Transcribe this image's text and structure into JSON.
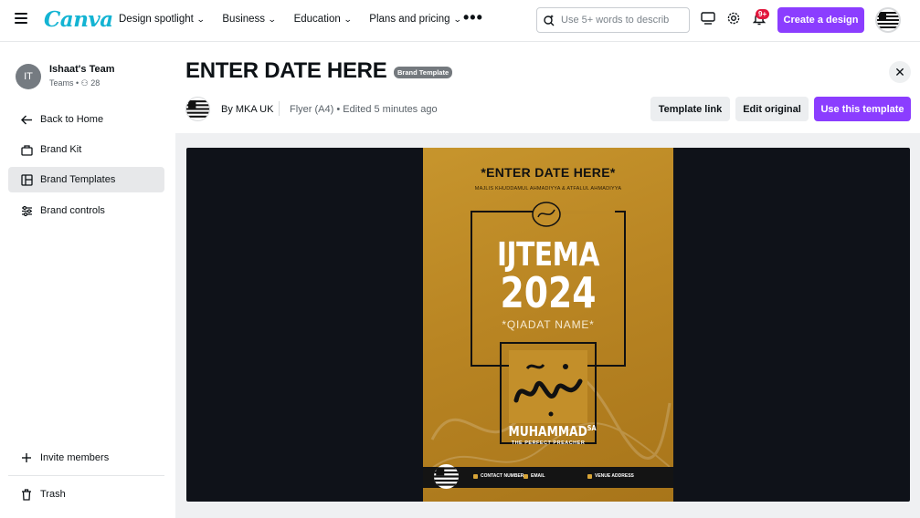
{
  "nav": {
    "logo": "Canva",
    "links": [
      "Design spotlight",
      "Business",
      "Education",
      "Plans and pricing"
    ],
    "search_placeholder": "Use 5+ words to describ",
    "notification_badge": "9+",
    "create_button": "Create a design"
  },
  "sidebar": {
    "team_initials": "IT",
    "team_name": "Ishaat's Team",
    "team_meta": "Teams • & 28",
    "items": [
      {
        "label": "Back to Home",
        "icon": "arrow-left-icon"
      },
      {
        "label": "Brand Kit",
        "icon": "brand-kit-icon"
      },
      {
        "label": "Brand Templates",
        "icon": "templates-icon"
      },
      {
        "label": "Brand controls",
        "icon": "sliders-icon"
      }
    ],
    "invite": "Invite members",
    "trash": "Trash"
  },
  "header": {
    "title": "ENTER DATE HERE",
    "badge": "Brand Template",
    "author": "By MKA UK",
    "meta": "Flyer (A4) • Edited 5 minutes ago",
    "template_link": "Template link",
    "edit_original": "Edit original",
    "use_template": "Use this template"
  },
  "flyer": {
    "date": "*ENTER DATE HERE*",
    "org": "MAJLIS KHUDDAMUL AHMADIYYA & ATFALUL AHMADIYYA",
    "title": "IJTEMA",
    "year": "2024",
    "qiadat": "*QIADAT NAME*",
    "name": "MUHAMMAD",
    "name_sup": "SA",
    "tagline": "THE PERFECT PREACHER",
    "contact": "CONTACT NUMBER",
    "email": "EMAIL",
    "venue": "VENUE ADDRESS"
  },
  "colors": {
    "accent": "#8b3dff",
    "canva_teal": "#14b4d3",
    "flyer_gold": "#b98523",
    "preview_bg": "#0f1219"
  }
}
